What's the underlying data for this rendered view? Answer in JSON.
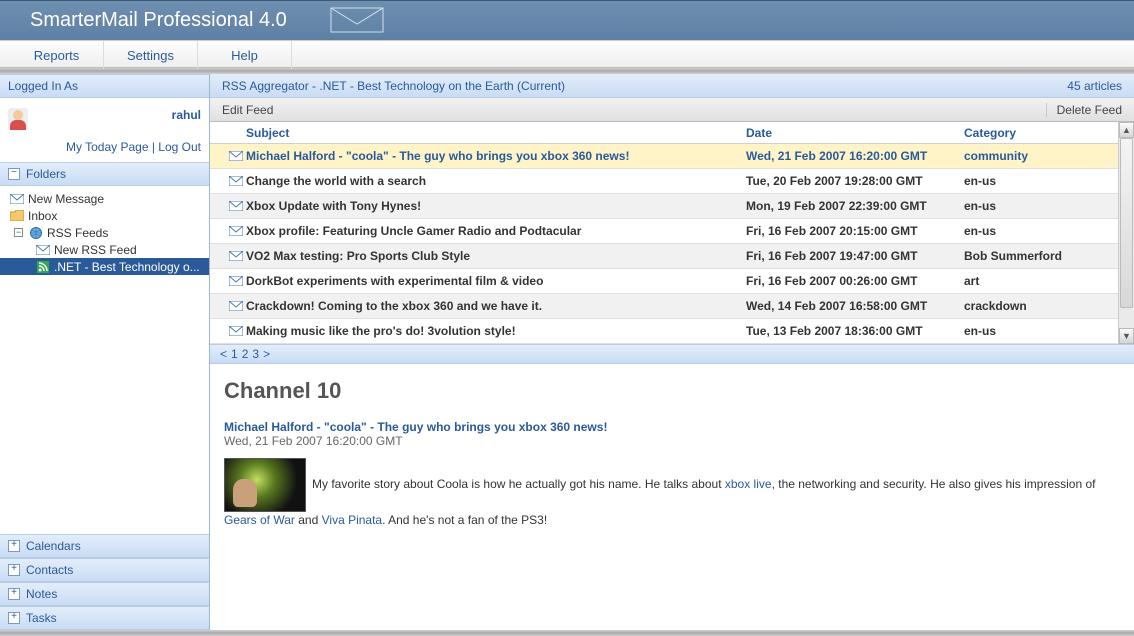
{
  "banner": {
    "title": "SmarterMail Professional 4.0"
  },
  "menu": {
    "reports": "Reports",
    "settings": "Settings",
    "help": "Help"
  },
  "sidebar": {
    "logged_in_header": "Logged In As",
    "user_name": "rahul",
    "my_today": "My Today Page",
    "log_out": "Log Out",
    "sep": " | ",
    "folders_header": "Folders",
    "new_message": "New Message",
    "inbox": "Inbox",
    "rss_feeds": "RSS Feeds",
    "new_rss_feed": "New RSS Feed",
    "feed_selected": ".NET - Best Technology o...",
    "calendars": "Calendars",
    "contacts": "Contacts",
    "notes": "Notes",
    "tasks": "Tasks"
  },
  "content": {
    "header": "RSS Aggregator - .NET - Best Technology on the Earth (Current)",
    "count": "45 articles",
    "edit_feed": "Edit Feed",
    "delete_feed": "Delete Feed",
    "cols": {
      "subject": "Subject",
      "date": "Date",
      "category": "Category"
    },
    "rows": [
      {
        "subject": "Michael Halford - \"coola\" - The guy who brings you xbox 360 news!",
        "date": "Wed, 21 Feb 2007 16:20:00 GMT",
        "category": "community"
      },
      {
        "subject": "Change the world with a search",
        "date": "Tue, 20 Feb 2007 19:28:00 GMT",
        "category": "en-us"
      },
      {
        "subject": "Xbox Update with Tony Hynes!",
        "date": "Mon, 19 Feb 2007 22:39:00 GMT",
        "category": "en-us"
      },
      {
        "subject": "Xbox profile: Featuring Uncle Gamer Radio and Podtacular",
        "date": "Fri, 16 Feb 2007 20:15:00 GMT",
        "category": "en-us"
      },
      {
        "subject": "VO2 Max testing: Pro Sports Club Style",
        "date": "Fri, 16 Feb 2007 19:47:00 GMT",
        "category": "Bob Summerford"
      },
      {
        "subject": "DorkBot experiments with experimental film & video",
        "date": "Fri, 16 Feb 2007 00:26:00 GMT",
        "category": "art"
      },
      {
        "subject": "Crackdown! Coming to the xbox 360 and we have it.",
        "date": "Wed, 14 Feb 2007 16:58:00 GMT",
        "category": "crackdown"
      },
      {
        "subject": "Making music like the pro's do! 3volution style!",
        "date": "Tue, 13 Feb 2007 18:36:00 GMT",
        "category": "en-us"
      }
    ],
    "pager": {
      "prev": "<",
      "p1": "1",
      "p2": "2",
      "p3": "3",
      "next": ">"
    },
    "article": {
      "channel": "Channel 10",
      "title": "Michael Halford - \"coola\" - The guy who brings you xbox 360 news!",
      "date": "Wed, 21 Feb 2007 16:20:00 GMT",
      "body_pre": "My favorite story about Coola is how he actually got his name.  He talks about ",
      "link1": "xbox live",
      "body_mid1": ", the networking and security.  He also gives his impression of ",
      "link2": "Gears of War",
      "body_mid2": " and ",
      "link3": "Viva Pinata",
      "body_post": ".  And he's not a fan of the PS3!"
    }
  }
}
